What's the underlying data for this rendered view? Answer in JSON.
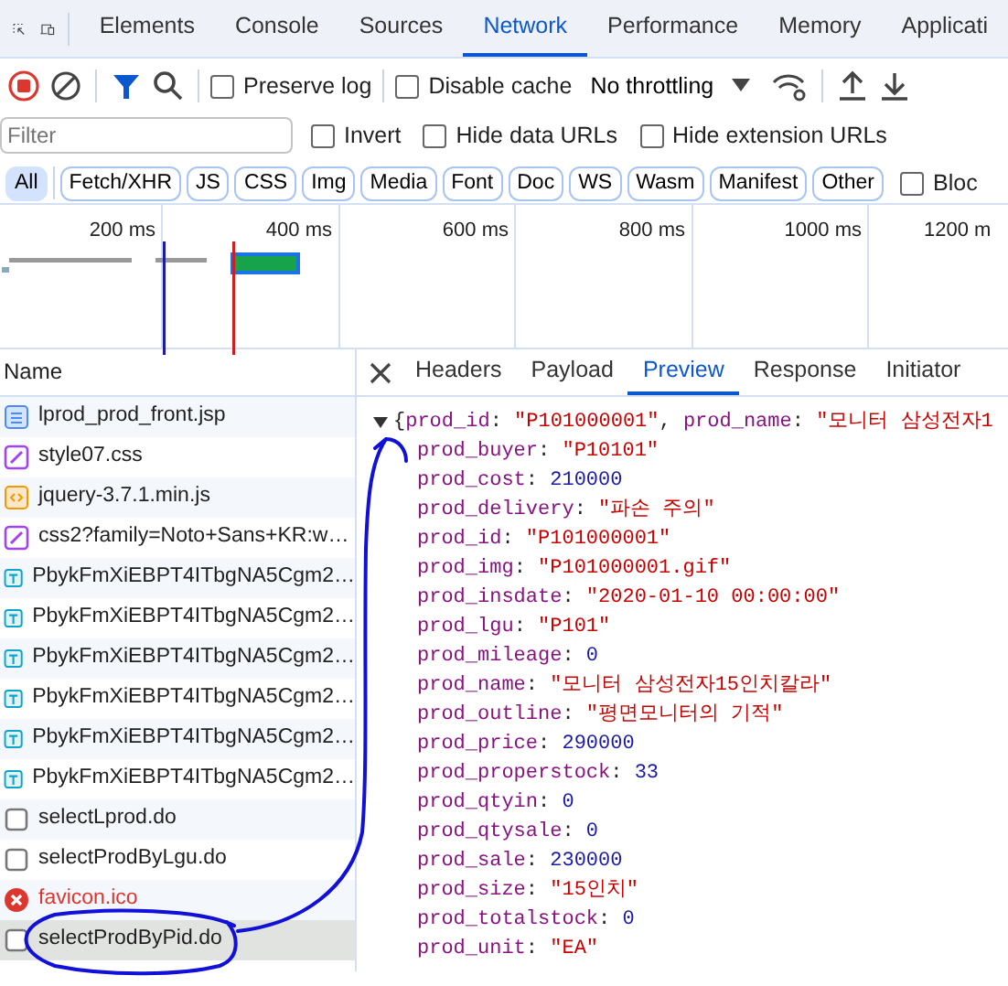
{
  "top_tabs": [
    {
      "label": "Elements",
      "selected": false
    },
    {
      "label": "Console",
      "selected": false
    },
    {
      "label": "Sources",
      "selected": false
    },
    {
      "label": "Network",
      "selected": true
    },
    {
      "label": "Performance",
      "selected": false
    },
    {
      "label": "Memory",
      "selected": false
    },
    {
      "label": "Applicati",
      "selected": false
    }
  ],
  "toolbar": {
    "recording": true,
    "filter_active": true,
    "preserve_log": {
      "label": "Preserve log",
      "checked": false
    },
    "disable_cache": {
      "label": "Disable cache",
      "checked": false
    },
    "throttling": "No throttling"
  },
  "filter": {
    "placeholder": "Filter",
    "options": [
      {
        "label": "Invert",
        "checked": false
      },
      {
        "label": "Hide data URLs",
        "checked": false
      },
      {
        "label": "Hide extension URLs",
        "checked": false
      }
    ]
  },
  "type_filters": [
    {
      "label": "All",
      "selected": true
    },
    {
      "label": "Fetch/XHR",
      "selected": false
    },
    {
      "label": "JS",
      "selected": false
    },
    {
      "label": "CSS",
      "selected": false
    },
    {
      "label": "Img",
      "selected": false
    },
    {
      "label": "Media",
      "selected": false
    },
    {
      "label": "Font",
      "selected": false
    },
    {
      "label": "Doc",
      "selected": false
    },
    {
      "label": "WS",
      "selected": false
    },
    {
      "label": "Wasm",
      "selected": false
    },
    {
      "label": "Manifest",
      "selected": false
    },
    {
      "label": "Other",
      "selected": false
    }
  ],
  "blocked": {
    "label": "Bloc",
    "checked": false
  },
  "timeline": {
    "ticks": [
      "200 ms",
      "400 ms",
      "600 ms",
      "800 ms",
      "1000 ms",
      "1200 m"
    ]
  },
  "requests_header": "Name",
  "requests": [
    {
      "name": "lprod_prod_front.jsp",
      "kind": "doc",
      "selected": false
    },
    {
      "name": "style07.css",
      "kind": "css",
      "selected": false
    },
    {
      "name": "jquery-3.7.1.min.js",
      "kind": "js",
      "selected": false
    },
    {
      "name": "css2?family=Noto+Sans+KR:w…",
      "kind": "css",
      "selected": false
    },
    {
      "name": "PbykFmXiEBPT4ITbgNA5Cgm2…",
      "kind": "font",
      "selected": false
    },
    {
      "name": "PbykFmXiEBPT4ITbgNA5Cgm2…",
      "kind": "font",
      "selected": false
    },
    {
      "name": "PbykFmXiEBPT4ITbgNA5Cgm2…",
      "kind": "font",
      "selected": false
    },
    {
      "name": "PbykFmXiEBPT4ITbgNA5Cgm2…",
      "kind": "font",
      "selected": false
    },
    {
      "name": "PbykFmXiEBPT4ITbgNA5Cgm2…",
      "kind": "font",
      "selected": false
    },
    {
      "name": "PbykFmXiEBPT4ITbgNA5Cgm2…",
      "kind": "font",
      "selected": false
    },
    {
      "name": "selectLprod.do",
      "kind": "other",
      "selected": false
    },
    {
      "name": "selectProdByLgu.do",
      "kind": "other",
      "selected": false
    },
    {
      "name": "favicon.ico",
      "kind": "error",
      "selected": false
    },
    {
      "name": "selectProdByPid.do",
      "kind": "other",
      "selected": true
    }
  ],
  "detail_tabs": [
    {
      "label": "Headers",
      "selected": false
    },
    {
      "label": "Payload",
      "selected": false
    },
    {
      "label": "Preview",
      "selected": true
    },
    {
      "label": "Response",
      "selected": false
    },
    {
      "label": "Initiator",
      "selected": false
    }
  ],
  "preview": {
    "expanded": true,
    "separator": ":",
    "summary": [
      {
        "text": "{",
        "kind": "punct"
      },
      {
        "text": "prod_id",
        "kind": "key"
      },
      {
        "text": ": ",
        "kind": "punct"
      },
      {
        "text": "\"P101000001\"",
        "kind": "string"
      },
      {
        "text": ", ",
        "kind": "punct"
      },
      {
        "text": "prod_name",
        "kind": "key"
      },
      {
        "text": ": ",
        "kind": "punct"
      },
      {
        "text": "\"모니터 삼성전자1",
        "kind": "string"
      }
    ],
    "properties": [
      {
        "key": "prod_buyer",
        "value": "\"P10101\"",
        "kind": "string"
      },
      {
        "key": "prod_cost",
        "value": "210000",
        "kind": "number"
      },
      {
        "key": "prod_delivery",
        "value": "\"파손 주의\"",
        "kind": "string"
      },
      {
        "key": "prod_id",
        "value": "\"P101000001\"",
        "kind": "string"
      },
      {
        "key": "prod_img",
        "value": "\"P101000001.gif\"",
        "kind": "string"
      },
      {
        "key": "prod_insdate",
        "value": "\"2020-01-10 00:00:00\"",
        "kind": "string"
      },
      {
        "key": "prod_lgu",
        "value": "\"P101\"",
        "kind": "string"
      },
      {
        "key": "prod_mileage",
        "value": "0",
        "kind": "number"
      },
      {
        "key": "prod_name",
        "value": "\"모니터 삼성전자15인치칼라\"",
        "kind": "string"
      },
      {
        "key": "prod_outline",
        "value": "\"평면모니터의 기적\"",
        "kind": "string"
      },
      {
        "key": "prod_price",
        "value": "290000",
        "kind": "number"
      },
      {
        "key": "prod_properstock",
        "value": "33",
        "kind": "number"
      },
      {
        "key": "prod_qtyin",
        "value": "0",
        "kind": "number"
      },
      {
        "key": "prod_qtysale",
        "value": "0",
        "kind": "number"
      },
      {
        "key": "prod_sale",
        "value": "230000",
        "kind": "number"
      },
      {
        "key": "prod_size",
        "value": "\"15인치\"",
        "kind": "string"
      },
      {
        "key": "prod_totalstock",
        "value": "0",
        "kind": "number"
      },
      {
        "key": "prod_unit",
        "value": "\"EA\"",
        "kind": "string"
      }
    ]
  }
}
